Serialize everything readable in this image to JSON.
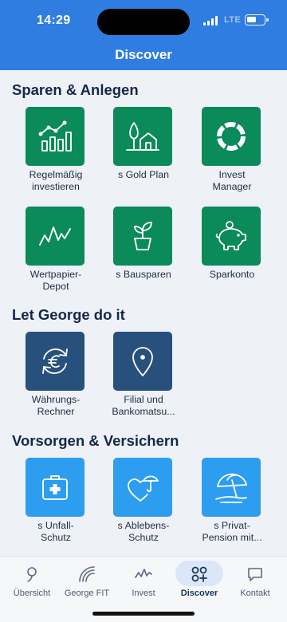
{
  "status": {
    "time": "14:29",
    "network": "LTE"
  },
  "header": {
    "title": "Discover"
  },
  "sections": [
    {
      "title": "Sparen & Anlegen",
      "tiles": [
        {
          "label": "Regelmäßig\ninvestieren",
          "icon": "chart-growth-icon"
        },
        {
          "label": "s Gold Plan",
          "icon": "tree-house-icon"
        },
        {
          "label": "Invest\nManager",
          "icon": "ring-chart-icon"
        },
        {
          "label": "Wertpapier-\nDepot",
          "icon": "stock-line-icon"
        },
        {
          "label": "s Bausparen",
          "icon": "plant-pot-icon"
        },
        {
          "label": "Sparkonto",
          "icon": "piggy-bank-icon"
        }
      ]
    },
    {
      "title": "Let George do it",
      "tiles": [
        {
          "label": "Währungs-\nRechner",
          "icon": "currency-exchange-icon"
        },
        {
          "label": "Filial und\nBankomatsu...",
          "icon": "location-pin-icon"
        }
      ]
    },
    {
      "title": "Vorsorgen & Versichern",
      "tiles": [
        {
          "label": "s Unfall-\nSchutz",
          "icon": "first-aid-kit-icon"
        },
        {
          "label": "s Ablebens-\nSchutz",
          "icon": "heart-umbrella-icon"
        },
        {
          "label": "s Privat-\nPension mit...",
          "icon": "beach-umbrella-icon"
        }
      ]
    }
  ],
  "tabbar": {
    "items": [
      {
        "label": "Übersicht",
        "icon": "overview-icon",
        "active": false
      },
      {
        "label": "George FIT",
        "icon": "fit-icon",
        "active": false
      },
      {
        "label": "Invest",
        "icon": "invest-icon",
        "active": false
      },
      {
        "label": "Discover",
        "icon": "discover-icon",
        "active": true
      },
      {
        "label": "Kontakt",
        "icon": "chat-icon",
        "active": false
      }
    ]
  },
  "colors": {
    "header": "#2f7de1",
    "green_tile": "#0b8a5a",
    "navy_tile": "#28507c",
    "blue_tile": "#2d9df0",
    "section_title": "#14284b",
    "background": "#eef1f6"
  }
}
